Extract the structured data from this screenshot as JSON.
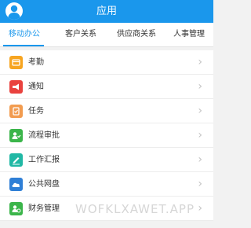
{
  "header": {
    "title": "应用"
  },
  "tabs": [
    {
      "label": "移动办公",
      "active": true
    },
    {
      "label": "客户关系",
      "active": false
    },
    {
      "label": "供应商关系",
      "active": false
    },
    {
      "label": "人事管理",
      "active": false
    }
  ],
  "items": [
    {
      "label": "考勤",
      "icon": "attendance-icon",
      "color": "#f7a520"
    },
    {
      "label": "通知",
      "icon": "megaphone-icon",
      "color": "#e9423e"
    },
    {
      "label": "任务",
      "icon": "clipboard-icon",
      "color": "#f29c50"
    },
    {
      "label": "流程审批",
      "icon": "approval-icon",
      "color": "#3bb54a"
    },
    {
      "label": "工作汇报",
      "icon": "edit-icon",
      "color": "#21b8a5"
    },
    {
      "label": "公共网盘",
      "icon": "cloud-icon",
      "color": "#2f7fd6"
    },
    {
      "label": "财务管理",
      "icon": "finance-icon",
      "color": "#3bb54a"
    }
  ],
  "chevron": "›",
  "watermark": "WOFKLXAWET.APP",
  "colors": {
    "primary": "#1a97ec",
    "background": "#f2f2f2"
  }
}
